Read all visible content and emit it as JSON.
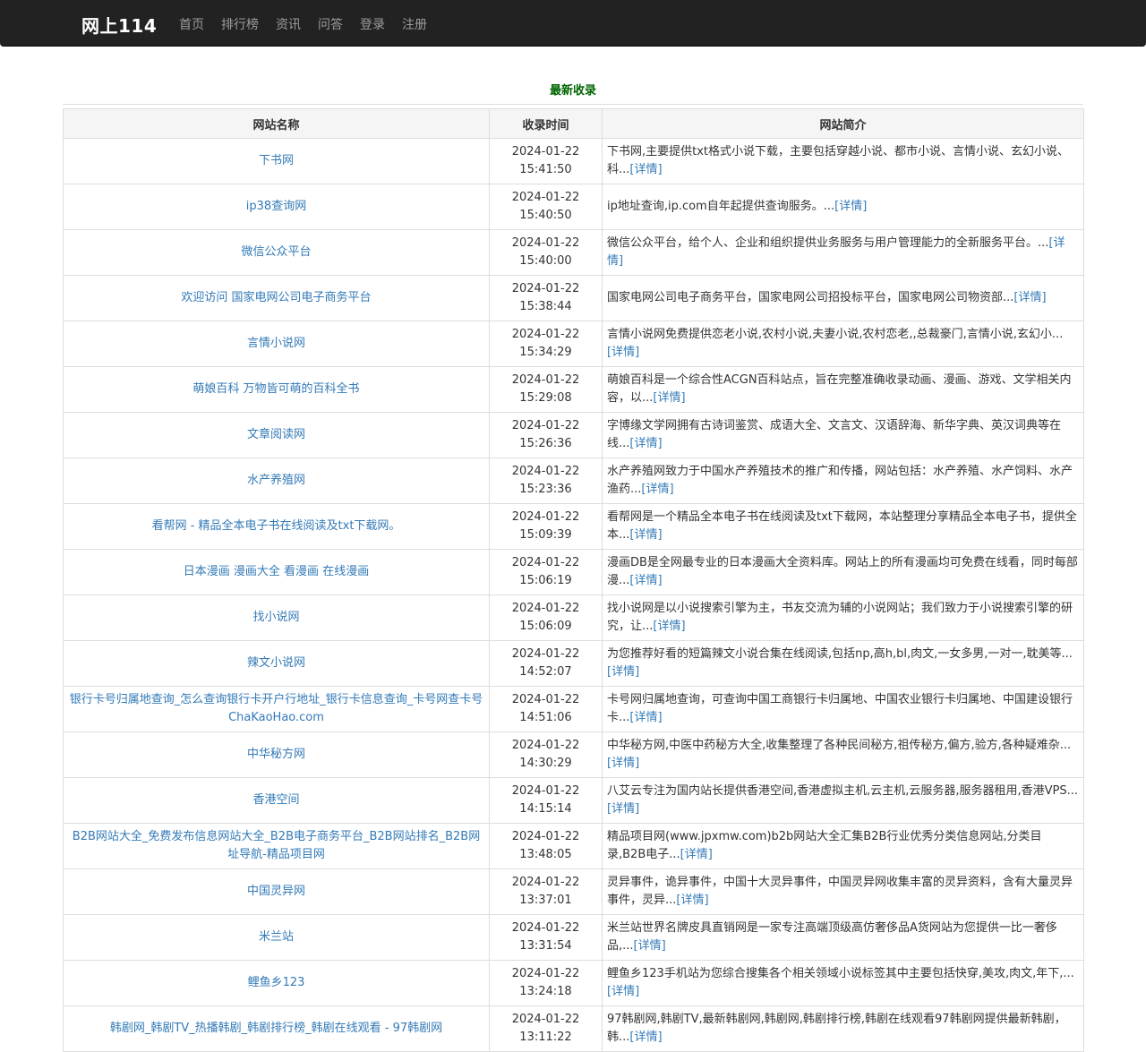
{
  "navbar": {
    "brand": "网上114",
    "links": [
      "首页",
      "排行榜",
      "资讯",
      "问答",
      "登录",
      "注册"
    ]
  },
  "section_title": "最新收录",
  "table": {
    "headers": [
      "网站名称",
      "收录时间",
      "网站简介"
    ],
    "detail_label": "[详情]",
    "rows": [
      {
        "name": "下书网",
        "date": "2024-01-22",
        "time": "15:41:50",
        "desc": "下书网,主要提供txt格式小说下载，主要包括穿越小说、都市小说、言情小说、玄幻小说、科..."
      },
      {
        "name": "ip38查询网",
        "date": "2024-01-22",
        "time": "15:40:50",
        "desc": "ip地址查询,ip.com自年起提供查询服务。..."
      },
      {
        "name": "微信公众平台",
        "date": "2024-01-22",
        "time": "15:40:00",
        "desc": "微信公众平台，给个人、企业和组织提供业务服务与用户管理能力的全新服务平台。..."
      },
      {
        "name": "欢迎访问 国家电网公司电子商务平台",
        "date": "2024-01-22",
        "time": "15:38:44",
        "desc": "国家电网公司电子商务平台，国家电网公司招投标平台，国家电网公司物资部..."
      },
      {
        "name": "言情小说网",
        "date": "2024-01-22",
        "time": "15:34:29",
        "desc": "言情小说网免费提供恋老小说,农村小说,夫妻小说,农村恋老,,总裁豪门,言情小说,玄幻小..."
      },
      {
        "name": "萌娘百科 万物皆可萌的百科全书",
        "date": "2024-01-22",
        "time": "15:29:08",
        "desc": "萌娘百科是一个综合性ACGN百科站点，旨在完整准确收录动画、漫画、游戏、文学相关内容，以..."
      },
      {
        "name": "文章阅读网",
        "date": "2024-01-22",
        "time": "15:26:36",
        "desc": "字博缘文学网拥有古诗词鉴赏、成语大全、文言文、汉语辞海、新华字典、英汉词典等在线..."
      },
      {
        "name": "水产养殖网",
        "date": "2024-01-22",
        "time": "15:23:36",
        "desc": "水产养殖网致力于中国水产养殖技术的推广和传播，网站包括：水产养殖、水产饲料、水产渔药..."
      },
      {
        "name": "看帮网 - 精品全本电子书在线阅读及txt下载网。",
        "date": "2024-01-22",
        "time": "15:09:39",
        "desc": "看帮网是一个精品全本电子书在线阅读及txt下载网，本站整理分享精品全本电子书，提供全本..."
      },
      {
        "name": "日本漫画 漫画大全 看漫画 在线漫画",
        "date": "2024-01-22",
        "time": "15:06:19",
        "desc": "漫画DB是全网最专业的日本漫画大全资料库。网站上的所有漫画均可免费在线看，同时每部漫..."
      },
      {
        "name": "找小说网",
        "date": "2024-01-22",
        "time": "15:06:09",
        "desc": "找小说网是以小说搜索引擎为主，书友交流为辅的小说网站；我们致力于小说搜索引擎的研究，让..."
      },
      {
        "name": "辣文小说网",
        "date": "2024-01-22",
        "time": "14:52:07",
        "desc": "为您推荐好看的短篇辣文小说合集在线阅读,包括np,高h,bl,肉文,一女多男,一对一,耽美等..."
      },
      {
        "name": "银行卡号归属地查询_怎么查询银行卡开户行地址_银行卡信息查询_卡号网查卡号ChaKaoHao.com",
        "date": "2024-01-22",
        "time": "14:51:06",
        "desc": "卡号网归属地查询，可查询中国工商银行卡归属地、中国农业银行卡归属地、中国建设银行卡..."
      },
      {
        "name": "中华秘方网",
        "date": "2024-01-22",
        "time": "14:30:29",
        "desc": "中华秘方网,中医中药秘方大全,收集整理了各种民间秘方,祖传秘方,偏方,验方,各种疑难杂..."
      },
      {
        "name": "香港空间",
        "date": "2024-01-22",
        "time": "14:15:14",
        "desc": "八艾云专注为国内站长提供香港空间,香港虚拟主机,云主机,云服务器,服务器租用,香港VPS..."
      },
      {
        "name": "B2B网站大全_免费发布信息网站大全_B2B电子商务平台_B2B网站排名_B2B网址导航-精品项目网",
        "date": "2024-01-22",
        "time": "13:48:05",
        "desc": "精品项目网(www.jpxmw.com)b2b网站大全汇集B2B行业优秀分类信息网站,分类目录,B2B电子..."
      },
      {
        "name": "中国灵异网",
        "date": "2024-01-22",
        "time": "13:37:01",
        "desc": "灵异事件，诡异事件，中国十大灵异事件，中国灵异网收集丰富的灵异资料，含有大量灵异事件，灵异..."
      },
      {
        "name": "米兰站",
        "date": "2024-01-22",
        "time": "13:31:54",
        "desc": "米兰站世界名牌皮具直销网是一家专注高端顶级高仿奢侈品A货网站为您提供一比一奢侈品,..."
      },
      {
        "name": "鲤鱼乡123",
        "date": "2024-01-22",
        "time": "13:24:18",
        "desc": "鲤鱼乡123手机站为您综合搜集各个相关领域小说标签其中主要包括快穿,美攻,肉文,年下,..."
      },
      {
        "name": "韩剧网_韩剧TV_热播韩剧_韩剧排行榜_韩剧在线观看 - 97韩剧网",
        "date": "2024-01-22",
        "time": "13:11:22",
        "desc": "97韩剧网,韩剧TV,最新韩剧网,韩剧网,韩剧排行榜,韩剧在线观看97韩剧网提供最新韩剧，韩..."
      }
    ]
  }
}
